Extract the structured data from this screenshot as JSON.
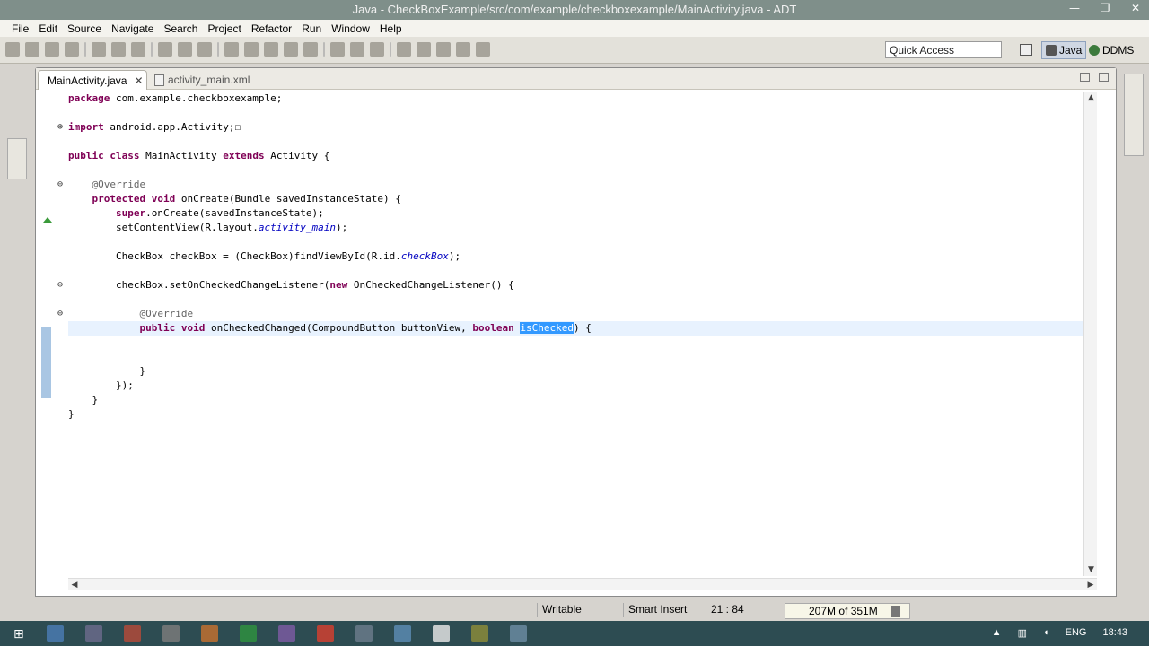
{
  "window": {
    "title": "Java - CheckBoxExample/src/com/example/checkboxexample/MainActivity.java - ADT",
    "controls": [
      "—",
      "❐",
      "✕"
    ]
  },
  "menu": [
    "File",
    "Edit",
    "Source",
    "Navigate",
    "Search",
    "Project",
    "Refactor",
    "Run",
    "Window",
    "Help"
  ],
  "toolbar": {
    "quick_access_placeholder": "Quick Access",
    "perspectives": [
      "Java",
      "DDMS"
    ]
  },
  "editor": {
    "tabs": [
      {
        "label": "MainActivity.java",
        "active": true,
        "close": "✕"
      },
      {
        "label": "activity_main.xml",
        "active": false
      }
    ],
    "code": [
      "package com.example.checkboxexample;",
      "",
      "import android.app.Activity;",
      "",
      "public class MainActivity extends Activity {",
      "",
      "    @Override",
      "    protected void onCreate(Bundle savedInstanceState) {",
      "        super.onCreate(savedInstanceState);",
      "        setContentView(R.layout.activity_main);",
      "",
      "        CheckBox checkBox = (CheckBox)findViewById(R.id.checkBox);",
      "",
      "        checkBox.setOnCheckedChangeListener(new OnCheckedChangeListener() {",
      "",
      "            @Override",
      "            public void onCheckedChanged(CompoundButton buttonView, boolean isChecked) {",
      "",
      "",
      "            }",
      "        });",
      "    }",
      "}"
    ],
    "selected_text": "isChecked"
  },
  "status": {
    "mode": "Writable",
    "insert": "Smart Insert",
    "position": "21 : 84",
    "heap": "207M of 351M"
  },
  "taskbar": {
    "language": "ENG",
    "time": "18:43"
  },
  "colors": {
    "keyword": "#7f0055",
    "annotation": "#646464",
    "field": "#0000c0",
    "selection": "#3399ff"
  }
}
